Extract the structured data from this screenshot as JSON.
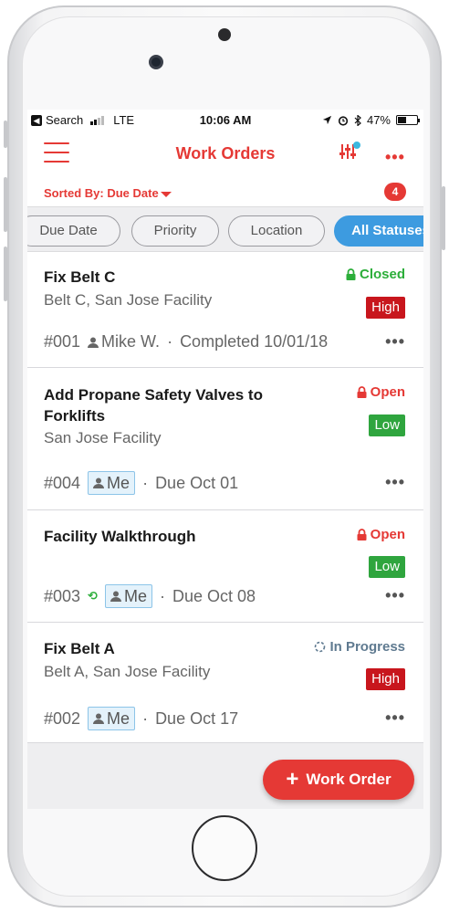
{
  "status_bar": {
    "carrier": "Search",
    "network": "LTE",
    "time": "10:06 AM",
    "battery": "47%",
    "battery_level": 0.47
  },
  "header": {
    "title": "Work Orders",
    "menu_icon": "hamburger-icon",
    "filter_icon": "filter-sliders-icon",
    "more_icon": "more-icon"
  },
  "sort": {
    "label": "Sorted By: Due Date",
    "count": "4"
  },
  "filters": [
    {
      "label": "Due Date"
    },
    {
      "label": "Priority"
    },
    {
      "label": "Location"
    },
    {
      "label": "All Statuses"
    }
  ],
  "work_orders": [
    {
      "title": "Fix Belt C",
      "subtitle": "Belt C, San Jose Facility",
      "status": "Closed",
      "priority": "High",
      "id": "#001",
      "assignee": "Mike W.",
      "separator": "·",
      "due": "Completed 10/01/18"
    },
    {
      "title": "Add Propane Safety Valves to Forklifts",
      "subtitle": "San Jose Facility",
      "status": "Open",
      "priority": "Low",
      "id": "#004",
      "assignee": "Me",
      "separator": "·",
      "due": "Due Oct 01"
    },
    {
      "title": "Facility Walkthrough",
      "subtitle": "",
      "status": "Open",
      "priority": "Low",
      "id": "#003",
      "assignee": "Me",
      "separator": "·",
      "due": "Due Oct 08"
    },
    {
      "title": "Fix Belt A",
      "subtitle": "Belt A, San Jose Facility",
      "status": "In Progress",
      "priority": "High",
      "id": "#002",
      "assignee": "Me",
      "separator": "·",
      "due": "Due Oct 17"
    }
  ],
  "fab": {
    "label": "Work Order"
  },
  "colors": {
    "accent": "#e53935",
    "closed": "#2cae3a",
    "in_progress": "#5f7a90",
    "high": "#c8161d",
    "low": "#2fa53e",
    "active_chip": "#3d9be0"
  }
}
